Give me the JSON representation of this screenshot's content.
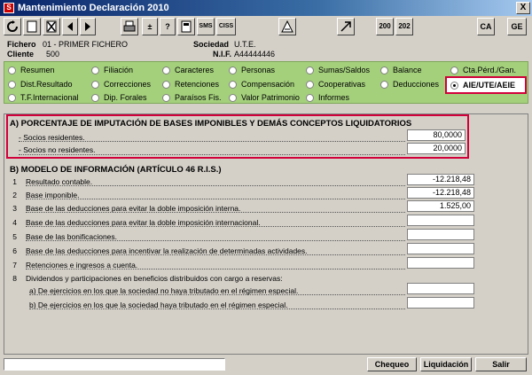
{
  "window": {
    "title": "Mantenimiento Declaración 2010",
    "app_icon": "S",
    "close_label": "X"
  },
  "toolbar": {
    "btn_sms": "SMS",
    "btn_ciss": "CISS",
    "btn_200": "200",
    "btn_202": "202",
    "btn_ca": "CA",
    "btn_ge": "GE"
  },
  "info": {
    "fichero_label": "Fichero",
    "fichero_value": "01 - PRIMER FICHERO",
    "cliente_label": "Cliente",
    "cliente_value": "500",
    "sociedad_label": "Sociedad",
    "sociedad_value": "U.T.E.",
    "nif_label": "N.I.F.",
    "nif_value": "A44444446"
  },
  "tabs": {
    "resumen": "Resumen",
    "filiacion": "Filiación",
    "caracteres": "Caracteres",
    "personas": "Personas",
    "sumas_saldos": "Sumas/Saldos",
    "balance": "Balance",
    "cta_perd": "Cta.Pérd./Gan.",
    "dist_resultado": "Dist.Resultado",
    "correcciones": "Correcciones",
    "retenciones": "Retenciones",
    "compensacion": "Compensación",
    "cooperativas": "Cooperativas",
    "deducciones": "Deducciones",
    "aie": "AIE/UTE/AEIE",
    "tf_internacional": "T.F.Internacional",
    "dip_forales": "Dip. Forales",
    "paraisos": "Paraísos Fis.",
    "valor_patrimonio": "Valor Patrimonio",
    "informes": "Informes"
  },
  "sectionA": {
    "title": "A) PORCENTAJE DE IMPUTACIÓN DE BASES IMPONIBLES Y DEMÁS CONCEPTOS LIQUIDATORIOS",
    "rows": [
      {
        "label": "- Socios residentes.",
        "value": "80,0000"
      },
      {
        "label": "- Socios no residentes.",
        "value": "20,0000"
      }
    ]
  },
  "sectionB": {
    "title": "B) MODELO DE INFORMACIÓN (ARTÍCULO 46 R.I.S.)",
    "rows": [
      {
        "num": "1",
        "label": "Resultado contable.",
        "value": "-12.218,48"
      },
      {
        "num": "2",
        "label": "Base imponible.",
        "value": "-12.218,48"
      },
      {
        "num": "3",
        "label": "Base de las deducciones para evitar la doble imposición interna.",
        "value": "1.525,00"
      },
      {
        "num": "4",
        "label": "Base de las deducciones para evitar la doble imposición internacional.",
        "value": ""
      },
      {
        "num": "5",
        "label": "Base de las bonificaciones.",
        "value": ""
      },
      {
        "num": "6",
        "label": "Base de las deducciones para incentivar la realización de determinadas actividades.",
        "value": ""
      },
      {
        "num": "7",
        "label": "Retenciones e ingresos a cuenta.",
        "value": ""
      },
      {
        "num": "8",
        "label": "Dividendos y participaciones en beneficios distribuidos con cargo a reservas:",
        "value": ""
      }
    ],
    "sub_rows": [
      {
        "label": "a) De ejercicios en los que la sociedad no haya tributado en el régimen especial.",
        "value": ""
      },
      {
        "label": "b) De ejercicios en los que la sociedad haya tributado en el régimen especial.",
        "value": ""
      }
    ]
  },
  "footer": {
    "chequeo": "Chequeo",
    "liquidacion": "Liquidación",
    "salir": "Salir"
  }
}
